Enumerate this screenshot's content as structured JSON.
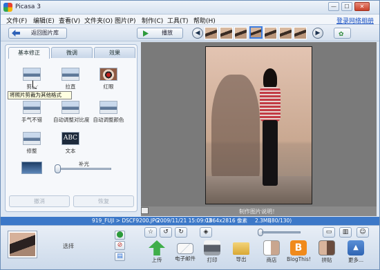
{
  "window": {
    "title": "Picasa 3",
    "minimize": "—",
    "maximize": "☐",
    "close": "✕"
  },
  "menu": {
    "items": [
      "文件(F)",
      "编辑(E)",
      "查看(V)",
      "文件夹(O)",
      "图片(P)",
      "制作(C)",
      "工具(T)",
      "帮助(H)"
    ],
    "login_link": "登录网络相册"
  },
  "toolbar": {
    "back_label": "返回图片库",
    "play_label": "播放",
    "prev_icon": "arrow-left-icon",
    "next_icon": "arrow-right-icon",
    "thumb_count": 7,
    "selected_thumb_index": 3
  },
  "tabs": [
    "基本修正",
    "微调",
    "效果"
  ],
  "tools": [
    {
      "label": "剪裁",
      "icon": "crop-icon"
    },
    {
      "label": "拉直",
      "icon": "straighten-icon"
    },
    {
      "label": "红眼",
      "icon": "red-eye-icon"
    },
    {
      "label": "手气不错",
      "icon": "feeling-lucky-icon"
    },
    {
      "label": "自动调整对比度",
      "icon": "auto-contrast-icon"
    },
    {
      "label": "自动调整颜色",
      "icon": "auto-color-icon"
    },
    {
      "label": "修整",
      "icon": "retouch-icon"
    },
    {
      "label": "文本",
      "icon": "text-icon"
    }
  ],
  "tooltip": "将照片剪裁为其他格式",
  "fill_light": {
    "label": "补光",
    "value": 0.0
  },
  "undo_label": "撤消",
  "redo_label": "恢复",
  "caption_placeholder": "制作图片说明！",
  "status": {
    "path": "919_FUJI > DSCF9200.JPG",
    "datetime": "2009/11/21 15:09:03",
    "dimensions": "1864x2816 像素",
    "size": "2.3MB",
    "position": "(80/130)"
  },
  "tray": {
    "select_label": "选择",
    "actions": [
      "上传",
      "电子邮件",
      "打印",
      "导出",
      "商店",
      "BlogThis!",
      "拼贴",
      "更多..."
    ]
  },
  "colors": {
    "status_bar": "#3c78c8",
    "accent": "#2a6fd6",
    "link": "#1a52c4"
  }
}
